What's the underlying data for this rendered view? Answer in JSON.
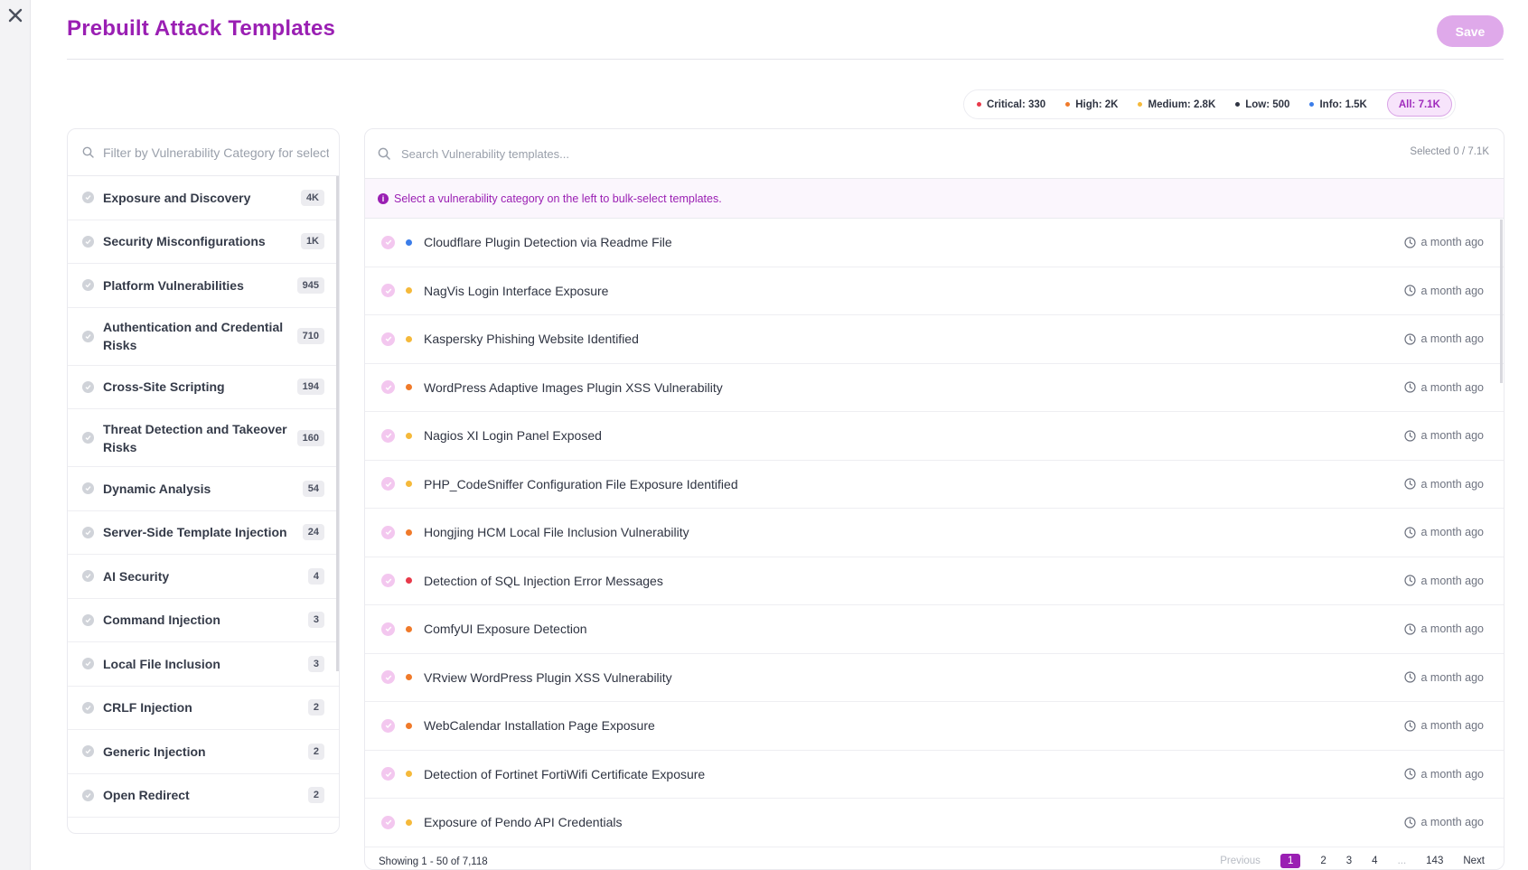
{
  "header": {
    "title": "Prebuilt Attack Templates",
    "save_label": "Save"
  },
  "severity_filters": [
    {
      "label": "Critical: 330",
      "color": "#e8394a"
    },
    {
      "label": "High: 2K",
      "color": "#f07a2a"
    },
    {
      "label": "Medium: 2.8K",
      "color": "#f5b93a"
    },
    {
      "label": "Low: 500",
      "color": "#2f3442"
    },
    {
      "label": "Info: 1.5K",
      "color": "#3b7de9"
    },
    {
      "label": "All: 7.1K",
      "color": "#a02bbd"
    }
  ],
  "categories": {
    "placeholder": "Filter by Vulnerability Category for selection",
    "items": [
      {
        "label": "Exposure and Discovery",
        "count": "4K"
      },
      {
        "label": "Security Misconfigurations",
        "count": "1K"
      },
      {
        "label": "Platform Vulnerabilities",
        "count": "945"
      },
      {
        "label": "Authentication and Credential Risks",
        "count": "710"
      },
      {
        "label": "Cross-Site Scripting",
        "count": "194"
      },
      {
        "label": "Threat Detection and Takeover Risks",
        "count": "160"
      },
      {
        "label": "Dynamic Analysis",
        "count": "54"
      },
      {
        "label": "Server-Side Template Injection",
        "count": "24"
      },
      {
        "label": "AI Security",
        "count": "4"
      },
      {
        "label": "Command Injection",
        "count": "3"
      },
      {
        "label": "Local File Inclusion",
        "count": "3"
      },
      {
        "label": "CRLF Injection",
        "count": "2"
      },
      {
        "label": "Generic Injection",
        "count": "2"
      },
      {
        "label": "Open Redirect",
        "count": "2"
      }
    ]
  },
  "templates": {
    "placeholder": "Search Vulnerability templates...",
    "selected": "Selected 0 / 7.1K",
    "banner": "Select a vulnerability category on the left to bulk-select templates.",
    "rows": [
      {
        "name": "Cloudflare Plugin Detection via Readme File",
        "severity_color": "#3b7de9",
        "time": "a month ago"
      },
      {
        "name": "NagVis Login Interface Exposure",
        "severity_color": "#f5b93a",
        "time": "a month ago"
      },
      {
        "name": "Kaspersky Phishing Website Identified",
        "severity_color": "#f5b93a",
        "time": "a month ago"
      },
      {
        "name": "WordPress Adaptive Images Plugin XSS Vulnerability",
        "severity_color": "#f07a2a",
        "time": "a month ago"
      },
      {
        "name": "Nagios XI Login Panel Exposed",
        "severity_color": "#f5b93a",
        "time": "a month ago"
      },
      {
        "name": "PHP_CodeSniffer Configuration File Exposure Identified",
        "severity_color": "#f5b93a",
        "time": "a month ago"
      },
      {
        "name": "Hongjing HCM Local File Inclusion Vulnerability",
        "severity_color": "#f07a2a",
        "time": "a month ago"
      },
      {
        "name": "Detection of SQL Injection Error Messages",
        "severity_color": "#e8394a",
        "time": "a month ago"
      },
      {
        "name": "ComfyUI Exposure Detection",
        "severity_color": "#f07a2a",
        "time": "a month ago"
      },
      {
        "name": "VRview WordPress Plugin XSS Vulnerability",
        "severity_color": "#f07a2a",
        "time": "a month ago"
      },
      {
        "name": "WebCalendar Installation Page Exposure",
        "severity_color": "#f07a2a",
        "time": "a month ago"
      },
      {
        "name": "Detection of Fortinet FortiWifi Certificate Exposure",
        "severity_color": "#f5b93a",
        "time": "a month ago"
      },
      {
        "name": "Exposure of Pendo API Credentials",
        "severity_color": "#f5b93a",
        "time": "a month ago"
      }
    ]
  },
  "footer": {
    "showing": "Showing 1 - 50 of 7,118",
    "previous": "Previous",
    "pages": [
      "1",
      "2",
      "3",
      "4",
      "...",
      "143"
    ],
    "next": "Next"
  }
}
